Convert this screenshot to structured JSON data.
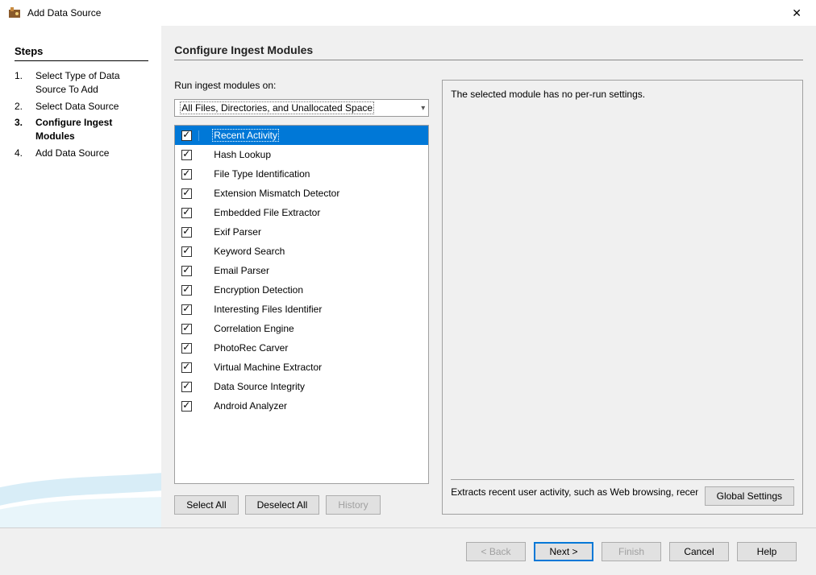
{
  "window": {
    "title": "Add Data Source"
  },
  "steps": {
    "heading": "Steps",
    "items": [
      {
        "num": "1.",
        "label": "Select Type of Data Source To Add",
        "current": false
      },
      {
        "num": "2.",
        "label": "Select Data Source",
        "current": false
      },
      {
        "num": "3.",
        "label": "Configure Ingest Modules",
        "current": true
      },
      {
        "num": "4.",
        "label": "Add Data Source",
        "current": false
      }
    ]
  },
  "main": {
    "title": "Configure Ingest Modules",
    "run_label": "Run ingest modules on:",
    "dropdown_value": "All Files, Directories, and Unallocated Space",
    "modules": [
      {
        "label": "Recent Activity",
        "checked": true,
        "selected": true
      },
      {
        "label": "Hash Lookup",
        "checked": true,
        "selected": false
      },
      {
        "label": "File Type Identification",
        "checked": true,
        "selected": false
      },
      {
        "label": "Extension Mismatch Detector",
        "checked": true,
        "selected": false
      },
      {
        "label": "Embedded File Extractor",
        "checked": true,
        "selected": false
      },
      {
        "label": "Exif Parser",
        "checked": true,
        "selected": false
      },
      {
        "label": "Keyword Search",
        "checked": true,
        "selected": false
      },
      {
        "label": "Email Parser",
        "checked": true,
        "selected": false
      },
      {
        "label": "Encryption Detection",
        "checked": true,
        "selected": false
      },
      {
        "label": "Interesting Files Identifier",
        "checked": true,
        "selected": false
      },
      {
        "label": "Correlation Engine",
        "checked": true,
        "selected": false
      },
      {
        "label": "PhotoRec Carver",
        "checked": true,
        "selected": false
      },
      {
        "label": "Virtual Machine Extractor",
        "checked": true,
        "selected": false
      },
      {
        "label": "Data Source Integrity",
        "checked": true,
        "selected": false
      },
      {
        "label": "Android Analyzer",
        "checked": true,
        "selected": false
      }
    ],
    "buttons": {
      "select_all": "Select All",
      "deselect_all": "Deselect All",
      "history": "History"
    },
    "settings_message": "The selected module has no per-run settings.",
    "description": "Extracts recent user activity, such as Web browsing, recently us..",
    "global_settings": "Global Settings"
  },
  "footer": {
    "back": "< Back",
    "next": "Next >",
    "finish": "Finish",
    "cancel": "Cancel",
    "help": "Help"
  }
}
